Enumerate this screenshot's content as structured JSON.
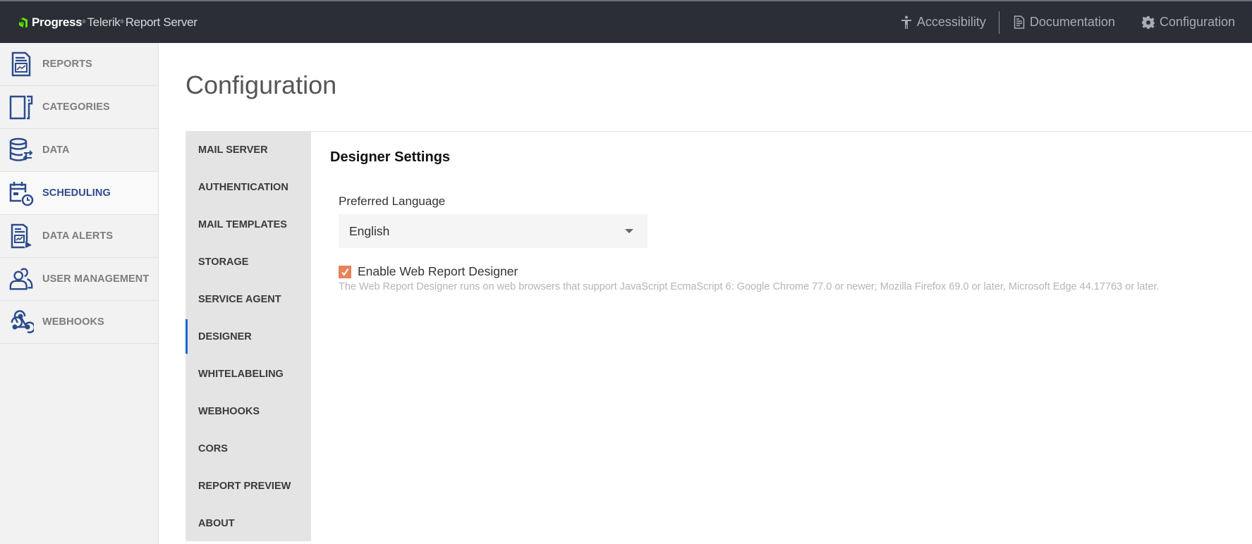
{
  "header": {
    "brand_primary": "Progress",
    "brand_secondary": "Telerik",
    "product": "Report Server",
    "links": [
      {
        "label": "Accessibility",
        "icon": "accessibility-icon"
      },
      {
        "label": "Documentation",
        "icon": "document-icon"
      },
      {
        "label": "Configuration",
        "icon": "gear-icon"
      }
    ]
  },
  "sidebar": {
    "items": [
      {
        "label": "REPORTS",
        "icon": "report-icon",
        "active": false
      },
      {
        "label": "CATEGORIES",
        "icon": "categories-icon",
        "active": false
      },
      {
        "label": "DATA",
        "icon": "database-icon",
        "active": false
      },
      {
        "label": "SCHEDULING",
        "icon": "calendar-clock-icon",
        "active": true
      },
      {
        "label": "DATA ALERTS",
        "icon": "data-alert-icon",
        "active": false
      },
      {
        "label": "USER MANAGEMENT",
        "icon": "users-icon",
        "active": false
      },
      {
        "label": "WEBHOOKS",
        "icon": "webhook-icon",
        "active": false
      }
    ]
  },
  "page": {
    "title": "Configuration"
  },
  "config_tabs": {
    "active": "DESIGNER",
    "items": [
      "MAIL SERVER",
      "AUTHENTICATION",
      "MAIL TEMPLATES",
      "STORAGE",
      "SERVICE AGENT",
      "DESIGNER",
      "WHITELABELING",
      "WEBHOOKS",
      "CORS",
      "REPORT PREVIEW",
      "ABOUT"
    ]
  },
  "designer": {
    "section_title": "Designer Settings",
    "language_label": "Preferred Language",
    "language_value": "English",
    "enable_label": "Enable Web Report Designer",
    "enable_checked": true,
    "help_text": "The Web Report Designer runs on web browsers that support JavaScript EcmaScript 6: Google Chrome 77.0 or newer; Mozilla Firefox 69.0 or later, Microsoft Edge 44.17763 or later."
  },
  "colors": {
    "header_bg": "#2b2e36",
    "brand_green": "#5ce500",
    "accent_blue": "#1a66d2",
    "icon_blue": "#2c4b8e",
    "checkbox": "#e8825a"
  }
}
